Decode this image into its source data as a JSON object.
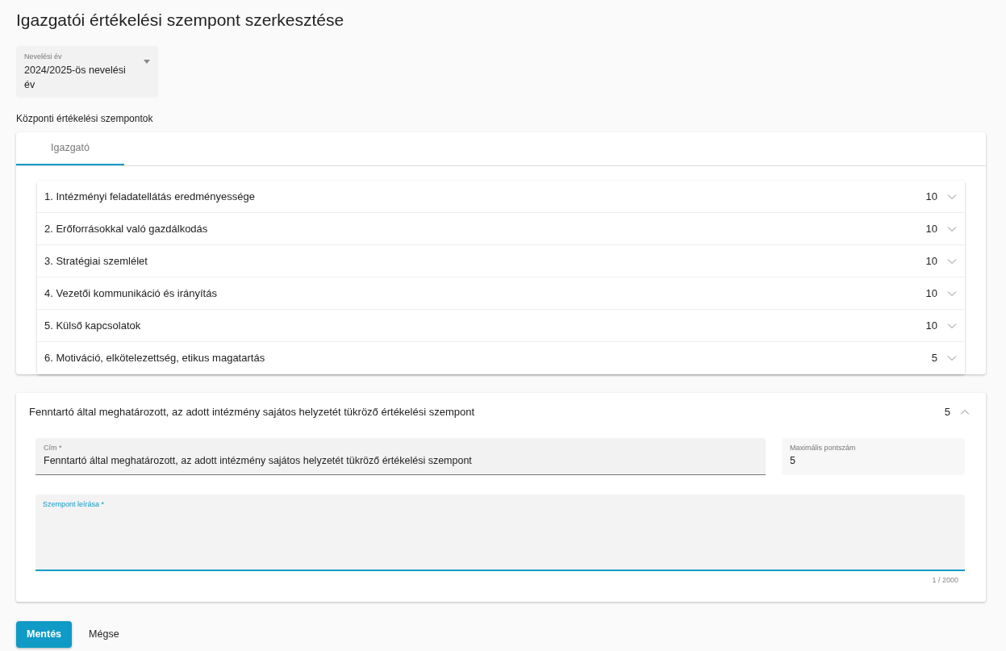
{
  "title": "Igazgatói értékelési szempont szerkesztése",
  "year_select": {
    "label": "Nevelési év",
    "value": "2024/2025-ös nevelési év"
  },
  "section_label": "Központi értékelési szempontok",
  "tabs": [
    {
      "label": "Igazgató",
      "selected": true
    }
  ],
  "criteria": [
    {
      "number": "1.",
      "title": "Intézményi feladatellátás eredményessége",
      "points": "10",
      "expanded": false
    },
    {
      "number": "2.",
      "title": "Erőforrásokkal való gazdálkodás",
      "points": "10",
      "expanded": false
    },
    {
      "number": "3.",
      "title": "Stratégiai szemlélet",
      "points": "10",
      "expanded": false
    },
    {
      "number": "4.",
      "title": "Vezetői kommunikáció és irányítás",
      "points": "10",
      "expanded": false
    },
    {
      "number": "5.",
      "title": "Külső kapcsolatok",
      "points": "10",
      "expanded": false
    },
    {
      "number": "6.",
      "title": "Motiváció, elkötelezettség, etikus magatartás",
      "points": "5",
      "expanded": false
    }
  ],
  "custom": {
    "title": "Fenntartó által meghatározott, az adott intézmény sajátos helyzetét tükröző értékelési szempont",
    "points": "5",
    "expanded": true,
    "title_field": {
      "label": "Cím *",
      "value": "Fenntartó által meghatározott, az adott intézmény sajátos helyzetét tükröző értékelési szempont"
    },
    "max_field": {
      "label": "Maximális pontszám",
      "value": "5"
    },
    "description_field": {
      "label": "Szempont leírása *",
      "focused": true,
      "counter": "1 / 2000"
    }
  },
  "buttons": [
    {
      "label": "Mentés",
      "kind": "primary"
    },
    {
      "label": "Mégse",
      "kind": "text"
    }
  ]
}
